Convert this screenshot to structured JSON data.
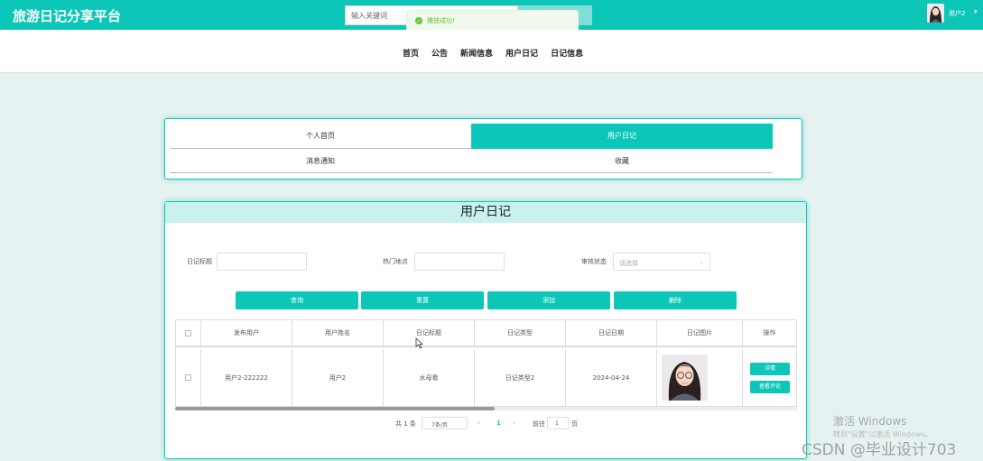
{
  "header": {
    "logo": "旅游日记分享平台",
    "search_placeholder": "输入关键词",
    "toast": "播放成功!",
    "user": "用户2",
    "caret": "▾"
  },
  "nav": {
    "items": [
      "首页",
      "公告",
      "新闻信息",
      "用户日记",
      "日记信息"
    ]
  },
  "tabs": {
    "items": [
      "个人首页",
      "用户日记",
      "消息通知",
      "收藏"
    ],
    "active": "用户日记"
  },
  "main": {
    "title": "用户日记",
    "filters": {
      "title_label": "日记标题",
      "spot_label": "热门地点",
      "status_label": "审核状态",
      "status_placeholder": "请选择"
    },
    "buttons": [
      "查询",
      "重置",
      "添加",
      "删除"
    ],
    "table": {
      "headers": [
        "发布用户",
        "用户姓名",
        "日记标题",
        "日记类型",
        "日记日期",
        "日记图片",
        "操作"
      ],
      "rows": [
        {
          "publisher": "用户2-222222",
          "name": "用户2",
          "title": "水母看",
          "type": "日记类型2",
          "date": "2024-04-24",
          "actions": [
            "详情",
            "查看评论"
          ]
        }
      ]
    },
    "pagination": {
      "total": "共 1 条",
      "page_size": "7条/页",
      "prev": "‹",
      "current": "1",
      "next": "›",
      "goto_label": "前往",
      "goto_value": "1",
      "page_suffix": "页"
    }
  },
  "overlay": {
    "activate_title": "激活 Windows",
    "activate_sub": "转到\"设置\"以激活 Windows。",
    "watermark": "CSDN @毕业设计703"
  },
  "colors": {
    "accent": "#0cc7b8",
    "title_bg": "#c9f1ed",
    "page_bg": "#e6f2f1"
  }
}
